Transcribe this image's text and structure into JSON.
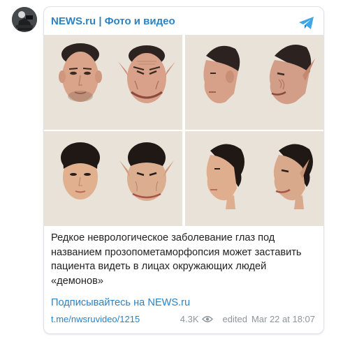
{
  "channel": {
    "name": "NEWS.ru | Фото и видео",
    "avatar_icon": "channel-avatar-photo"
  },
  "header_icon": "telegram-icon",
  "media": {
    "panels": [
      {
        "name": "male-face-front-normal-and-distorted"
      },
      {
        "name": "male-face-profile-normal-and-distorted"
      },
      {
        "name": "female-face-front-normal-and-distorted"
      },
      {
        "name": "female-face-profile-normal-and-distorted"
      }
    ]
  },
  "post": {
    "text": "Редкое неврологическое заболевание глаз под названием прозопометаморфопсия может заставить пациента видеть в лицах окружающих людей «демонов»",
    "subscribe_link": "Подписывайтесь на NEWS.ru",
    "post_link": "t.me/nwsruvideo/1215",
    "views": "4.3K",
    "edited": "edited",
    "date": "Mar 22 at 18:07"
  },
  "colors": {
    "accent": "#2b82c4",
    "meta": "#8e959b",
    "panel_bg": "#e9e2d8"
  }
}
